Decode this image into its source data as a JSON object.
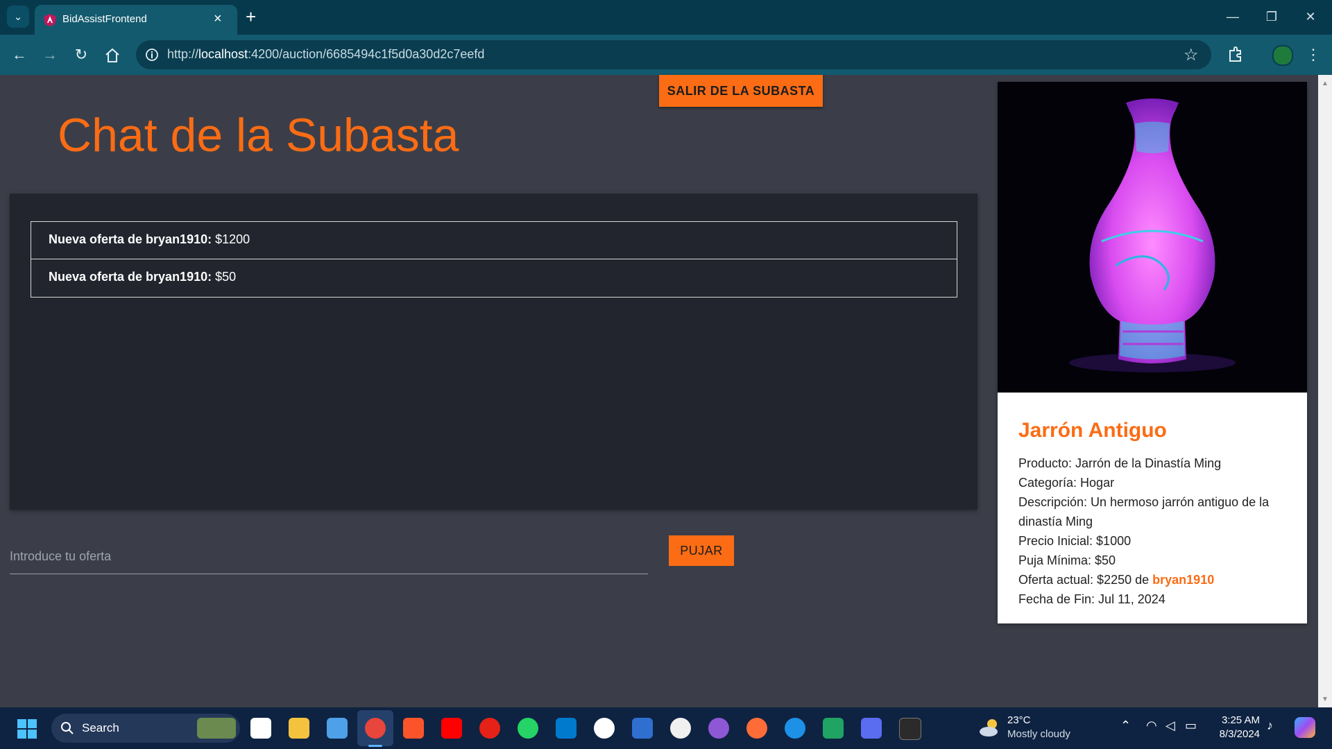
{
  "browser": {
    "tab_title": "BidAssistFrontend",
    "url_host": "localhost",
    "url_prefix": "http://",
    "url_rest": ":4200/auction/6685494c1f5d0a30d2c7eefd"
  },
  "page": {
    "exit_button": "SALIR DE LA SUBASTA",
    "chat_title": "Chat de la Subasta",
    "messages": [
      {
        "label": "Nueva oferta de bryan1910:",
        "amount": "$1200"
      },
      {
        "label": "Nueva oferta de bryan1910:",
        "amount": "$50"
      }
    ],
    "bid_placeholder": "Introduce tu oferta",
    "bid_button": "PUJAR"
  },
  "card": {
    "title": "Jarrón Antiguo",
    "producto": "Producto: Jarrón de la Dinastía Ming",
    "categoria": "Categoría: Hogar",
    "descripcion": "Descripción: Un hermoso jarrón antiguo de la dinastía Ming",
    "precio_inicial": "Precio Inicial: $1000",
    "puja_minima": "Puja Mínima: $50",
    "oferta_prefix": "Oferta actual: $2250 de",
    "oferta_user": "bryan1910",
    "fecha_fin": "Fecha de Fin: Jul 11, 2024"
  },
  "taskbar": {
    "search_label": "Search",
    "weather_temp": "23°C",
    "weather_desc": "Mostly cloudy",
    "time": "3:25 AM",
    "date": "8/3/2024"
  },
  "colors": {
    "accent": "#fb6c14",
    "page_bg": "#3b3e48",
    "chat_bg": "#22252e",
    "chrome": "#135a6e"
  }
}
